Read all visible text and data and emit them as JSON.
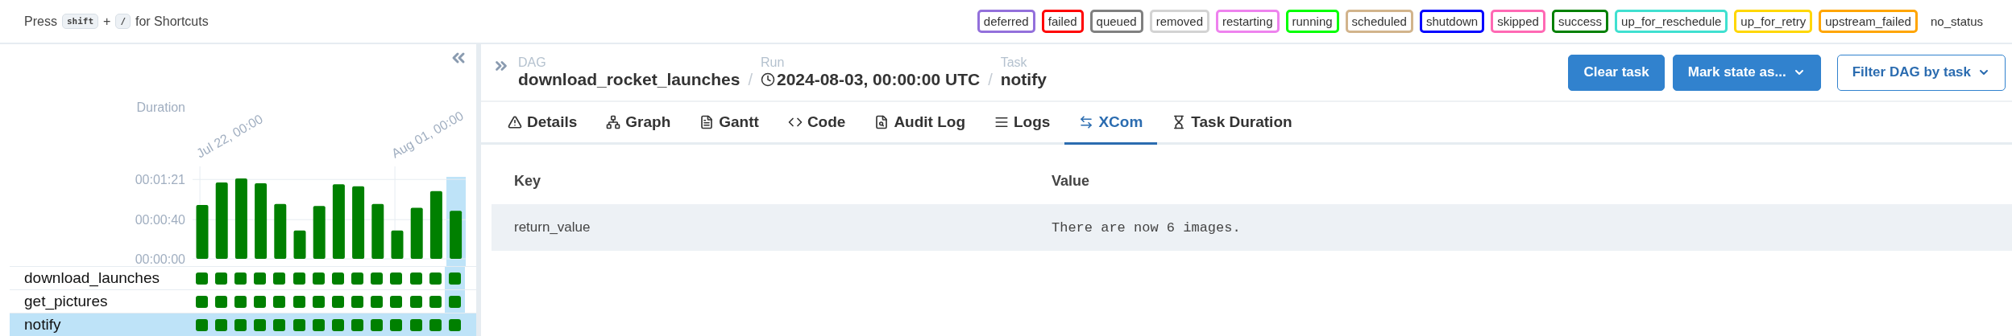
{
  "shortcut_hint": {
    "prefix": "Press",
    "keys": [
      "shift",
      "/"
    ],
    "joiner": "+",
    "suffix": "for Shortcuts"
  },
  "legend": [
    {
      "label": "deferred",
      "color": "#9370db"
    },
    {
      "label": "failed",
      "color": "#ff0000"
    },
    {
      "label": "queued",
      "color": "#808080"
    },
    {
      "label": "removed",
      "color": "#d3d3d3"
    },
    {
      "label": "restarting",
      "color": "#ee82ee"
    },
    {
      "label": "running",
      "color": "#00ff00"
    },
    {
      "label": "scheduled",
      "color": "#d2b48c"
    },
    {
      "label": "shutdown",
      "color": "#0000ff"
    },
    {
      "label": "skipped",
      "color": "#ff69b4"
    },
    {
      "label": "success",
      "color": "#008000"
    },
    {
      "label": "up_for_reschedule",
      "color": "#40e0d0"
    },
    {
      "label": "up_for_retry",
      "color": "#ffd700"
    },
    {
      "label": "upstream_failed",
      "color": "#ffa500"
    },
    {
      "label": "no_status"
    }
  ],
  "grid": {
    "chart_data": {
      "type": "bar",
      "ylabel": "Duration",
      "values": [
        55,
        78,
        82,
        77,
        56,
        29,
        54,
        76,
        74,
        56,
        29,
        52,
        69,
        49
      ],
      "annotations": [
        "Jul 22, 00:00",
        "Aug 01, 00:00"
      ],
      "yticks": [
        {
          "value": 0,
          "label": "00:00:00"
        },
        {
          "value": 40,
          "label": "00:00:40"
        },
        {
          "value": 81,
          "label": "00:01:21"
        }
      ],
      "ylim": [
        0,
        82
      ]
    },
    "runs": [
      {
        "selected": false
      },
      {
        "selected": false
      },
      {
        "selected": false
      },
      {
        "selected": false
      },
      {
        "selected": false
      },
      {
        "selected": false
      },
      {
        "selected": false
      },
      {
        "selected": false
      },
      {
        "selected": false
      },
      {
        "selected": false
      },
      {
        "selected": false
      },
      {
        "selected": false
      },
      {
        "selected": false
      },
      {
        "selected": true
      }
    ],
    "tasks": [
      {
        "name": "download_launches",
        "selected": false,
        "color": "#008000"
      },
      {
        "name": "get_pictures",
        "selected": false,
        "color": "#008000"
      },
      {
        "name": "notify",
        "selected": true,
        "color": "#008000"
      }
    ]
  },
  "breadcrumb": [
    {
      "label": "DAG",
      "value": "download_rocket_launches",
      "kind": "text"
    },
    {
      "label": "Run",
      "value": "2024-08-03, 00:00:00 UTC",
      "kind": "clock"
    },
    {
      "label": "Task",
      "value": "notify",
      "kind": "text"
    }
  ],
  "separator": "/",
  "actions": [
    {
      "label": "Clear task",
      "kind": "primary",
      "caret": false
    },
    {
      "label": "Mark state as...",
      "kind": "primary",
      "caret": true
    },
    {
      "label": "Filter DAG by task",
      "kind": "outline",
      "caret": true
    }
  ],
  "tabs": [
    {
      "label": "Details",
      "selected": false
    },
    {
      "label": "Graph",
      "selected": false
    },
    {
      "label": "Gantt",
      "selected": false
    },
    {
      "label": "Code",
      "selected": false
    },
    {
      "label": "Audit Log",
      "selected": false
    },
    {
      "label": "Logs",
      "selected": false
    },
    {
      "label": "XCom",
      "selected": true
    },
    {
      "label": "Task Duration",
      "selected": false
    }
  ],
  "table": {
    "columns": [
      "Key",
      "Value"
    ],
    "rows": [
      {
        "key": "return_value",
        "value": "There are now 6 images."
      }
    ]
  }
}
